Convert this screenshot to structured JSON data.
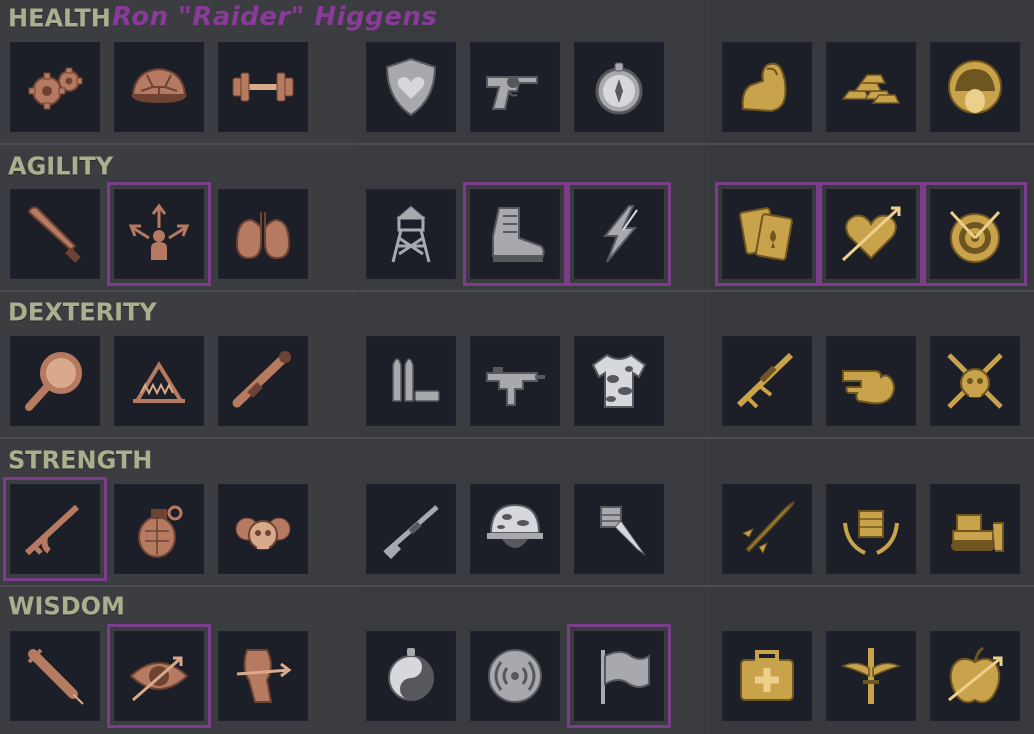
{
  "character": {
    "name": "Ron \"Raider\" Higgens"
  },
  "colors": {
    "selected_outline": "#7c3d8c",
    "label": "#a8b08e",
    "name": "#8a3a98"
  },
  "sections": [
    {
      "label": "HEALTH",
      "perks": [
        {
          "icon": "gears-icon",
          "selected": false
        },
        {
          "icon": "turtle-shell-icon",
          "selected": false
        },
        {
          "icon": "dumbbell-icon",
          "selected": false
        },
        {
          "icon": "heart-shield-icon",
          "selected": false
        },
        {
          "icon": "revolver-icon",
          "selected": false
        },
        {
          "icon": "compass-icon",
          "selected": false
        },
        {
          "icon": "flexed-arm-icon",
          "selected": false
        },
        {
          "icon": "gold-bars-icon",
          "selected": false
        },
        {
          "icon": "soldier-helmet-halo-icon",
          "selected": false
        }
      ]
    },
    {
      "label": "AGILITY",
      "perks": [
        {
          "icon": "machete-icon",
          "selected": false
        },
        {
          "icon": "person-arrows-icon",
          "selected": true
        },
        {
          "icon": "lungs-icon",
          "selected": false
        },
        {
          "icon": "watchtower-icon",
          "selected": false
        },
        {
          "icon": "combat-boot-icon",
          "selected": true
        },
        {
          "icon": "lightning-bolt-icon",
          "selected": true
        },
        {
          "icon": "playing-cards-icon",
          "selected": true
        },
        {
          "icon": "heart-arrow-icon",
          "selected": true
        },
        {
          "icon": "target-arrows-icon",
          "selected": true
        }
      ]
    },
    {
      "label": "DEXTERITY",
      "perks": [
        {
          "icon": "magnifying-glass-icon",
          "selected": false
        },
        {
          "icon": "bear-trap-icon",
          "selected": false
        },
        {
          "icon": "rocket-launcher-icon",
          "selected": false
        },
        {
          "icon": "bullets-icon",
          "selected": false
        },
        {
          "icon": "submachine-gun-icon",
          "selected": false
        },
        {
          "icon": "camo-shirt-icon",
          "selected": false
        },
        {
          "icon": "sniper-rifle-icon",
          "selected": false
        },
        {
          "icon": "finger-gun-icon",
          "selected": false
        },
        {
          "icon": "skull-crossed-knives-icon",
          "selected": false
        }
      ]
    },
    {
      "label": "STRENGTH",
      "perks": [
        {
          "icon": "assault-rifle-icon",
          "selected": true
        },
        {
          "icon": "grenade-icon",
          "selected": false
        },
        {
          "icon": "skulls-icon",
          "selected": false
        },
        {
          "icon": "shotgun-icon",
          "selected": false
        },
        {
          "icon": "camo-helmet-icon",
          "selected": false
        },
        {
          "icon": "fist-knife-icon",
          "selected": false
        },
        {
          "icon": "missile-icon",
          "selected": false
        },
        {
          "icon": "raised-fist-laurel-icon",
          "selected": false
        },
        {
          "icon": "bulldozer-icon",
          "selected": false
        }
      ]
    },
    {
      "label": "WISDOM",
      "perks": [
        {
          "icon": "syringe-icon",
          "selected": false
        },
        {
          "icon": "eye-arrow-icon",
          "selected": true
        },
        {
          "icon": "arrow-knee-icon",
          "selected": false
        },
        {
          "icon": "yin-yang-icon",
          "selected": false
        },
        {
          "icon": "radio-signal-icon",
          "selected": false
        },
        {
          "icon": "flag-icon",
          "selected": true
        },
        {
          "icon": "medkit-icon",
          "selected": false
        },
        {
          "icon": "winged-sword-icon",
          "selected": false
        },
        {
          "icon": "apple-arrow-icon",
          "selected": false
        }
      ]
    }
  ]
}
